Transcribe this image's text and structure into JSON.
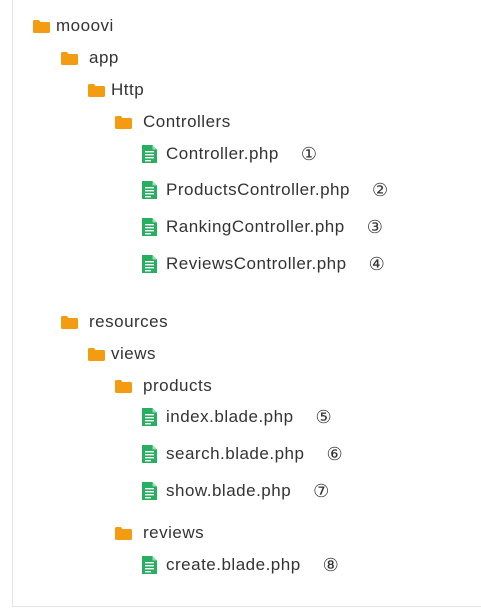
{
  "colors": {
    "folder": "#f39c12",
    "file": "#27ae60",
    "text": "#333333"
  },
  "tree": [
    {
      "type": "folder",
      "name": "mooovi",
      "level": 0
    },
    {
      "type": "folder",
      "name": "app",
      "level": 1
    },
    {
      "type": "folder",
      "name": "Http",
      "level": 2
    },
    {
      "type": "folder",
      "name": "Controllers",
      "level": 3
    },
    {
      "type": "file",
      "name": "Controller.php",
      "level": 4,
      "number": "①"
    },
    {
      "type": "file",
      "name": "ProductsController.php",
      "level": 4,
      "number": "②"
    },
    {
      "type": "file",
      "name": "RankingController.php",
      "level": 4,
      "number": "③"
    },
    {
      "type": "file",
      "name": "ReviewsController.php",
      "level": 4,
      "number": "④"
    },
    {
      "type": "folder",
      "name": "resources",
      "level": 1
    },
    {
      "type": "folder",
      "name": "views",
      "level": 2
    },
    {
      "type": "folder",
      "name": "products",
      "level": 3
    },
    {
      "type": "file",
      "name": "index.blade.php",
      "level": 4,
      "number": "⑤"
    },
    {
      "type": "file",
      "name": "search.blade.php",
      "level": 4,
      "number": "⑥"
    },
    {
      "type": "file",
      "name": "show.blade.php",
      "level": 4,
      "number": "⑦"
    },
    {
      "type": "folder",
      "name": "reviews",
      "level": 3
    },
    {
      "type": "file",
      "name": "create.blade.php",
      "level": 4,
      "number": "⑧"
    }
  ]
}
